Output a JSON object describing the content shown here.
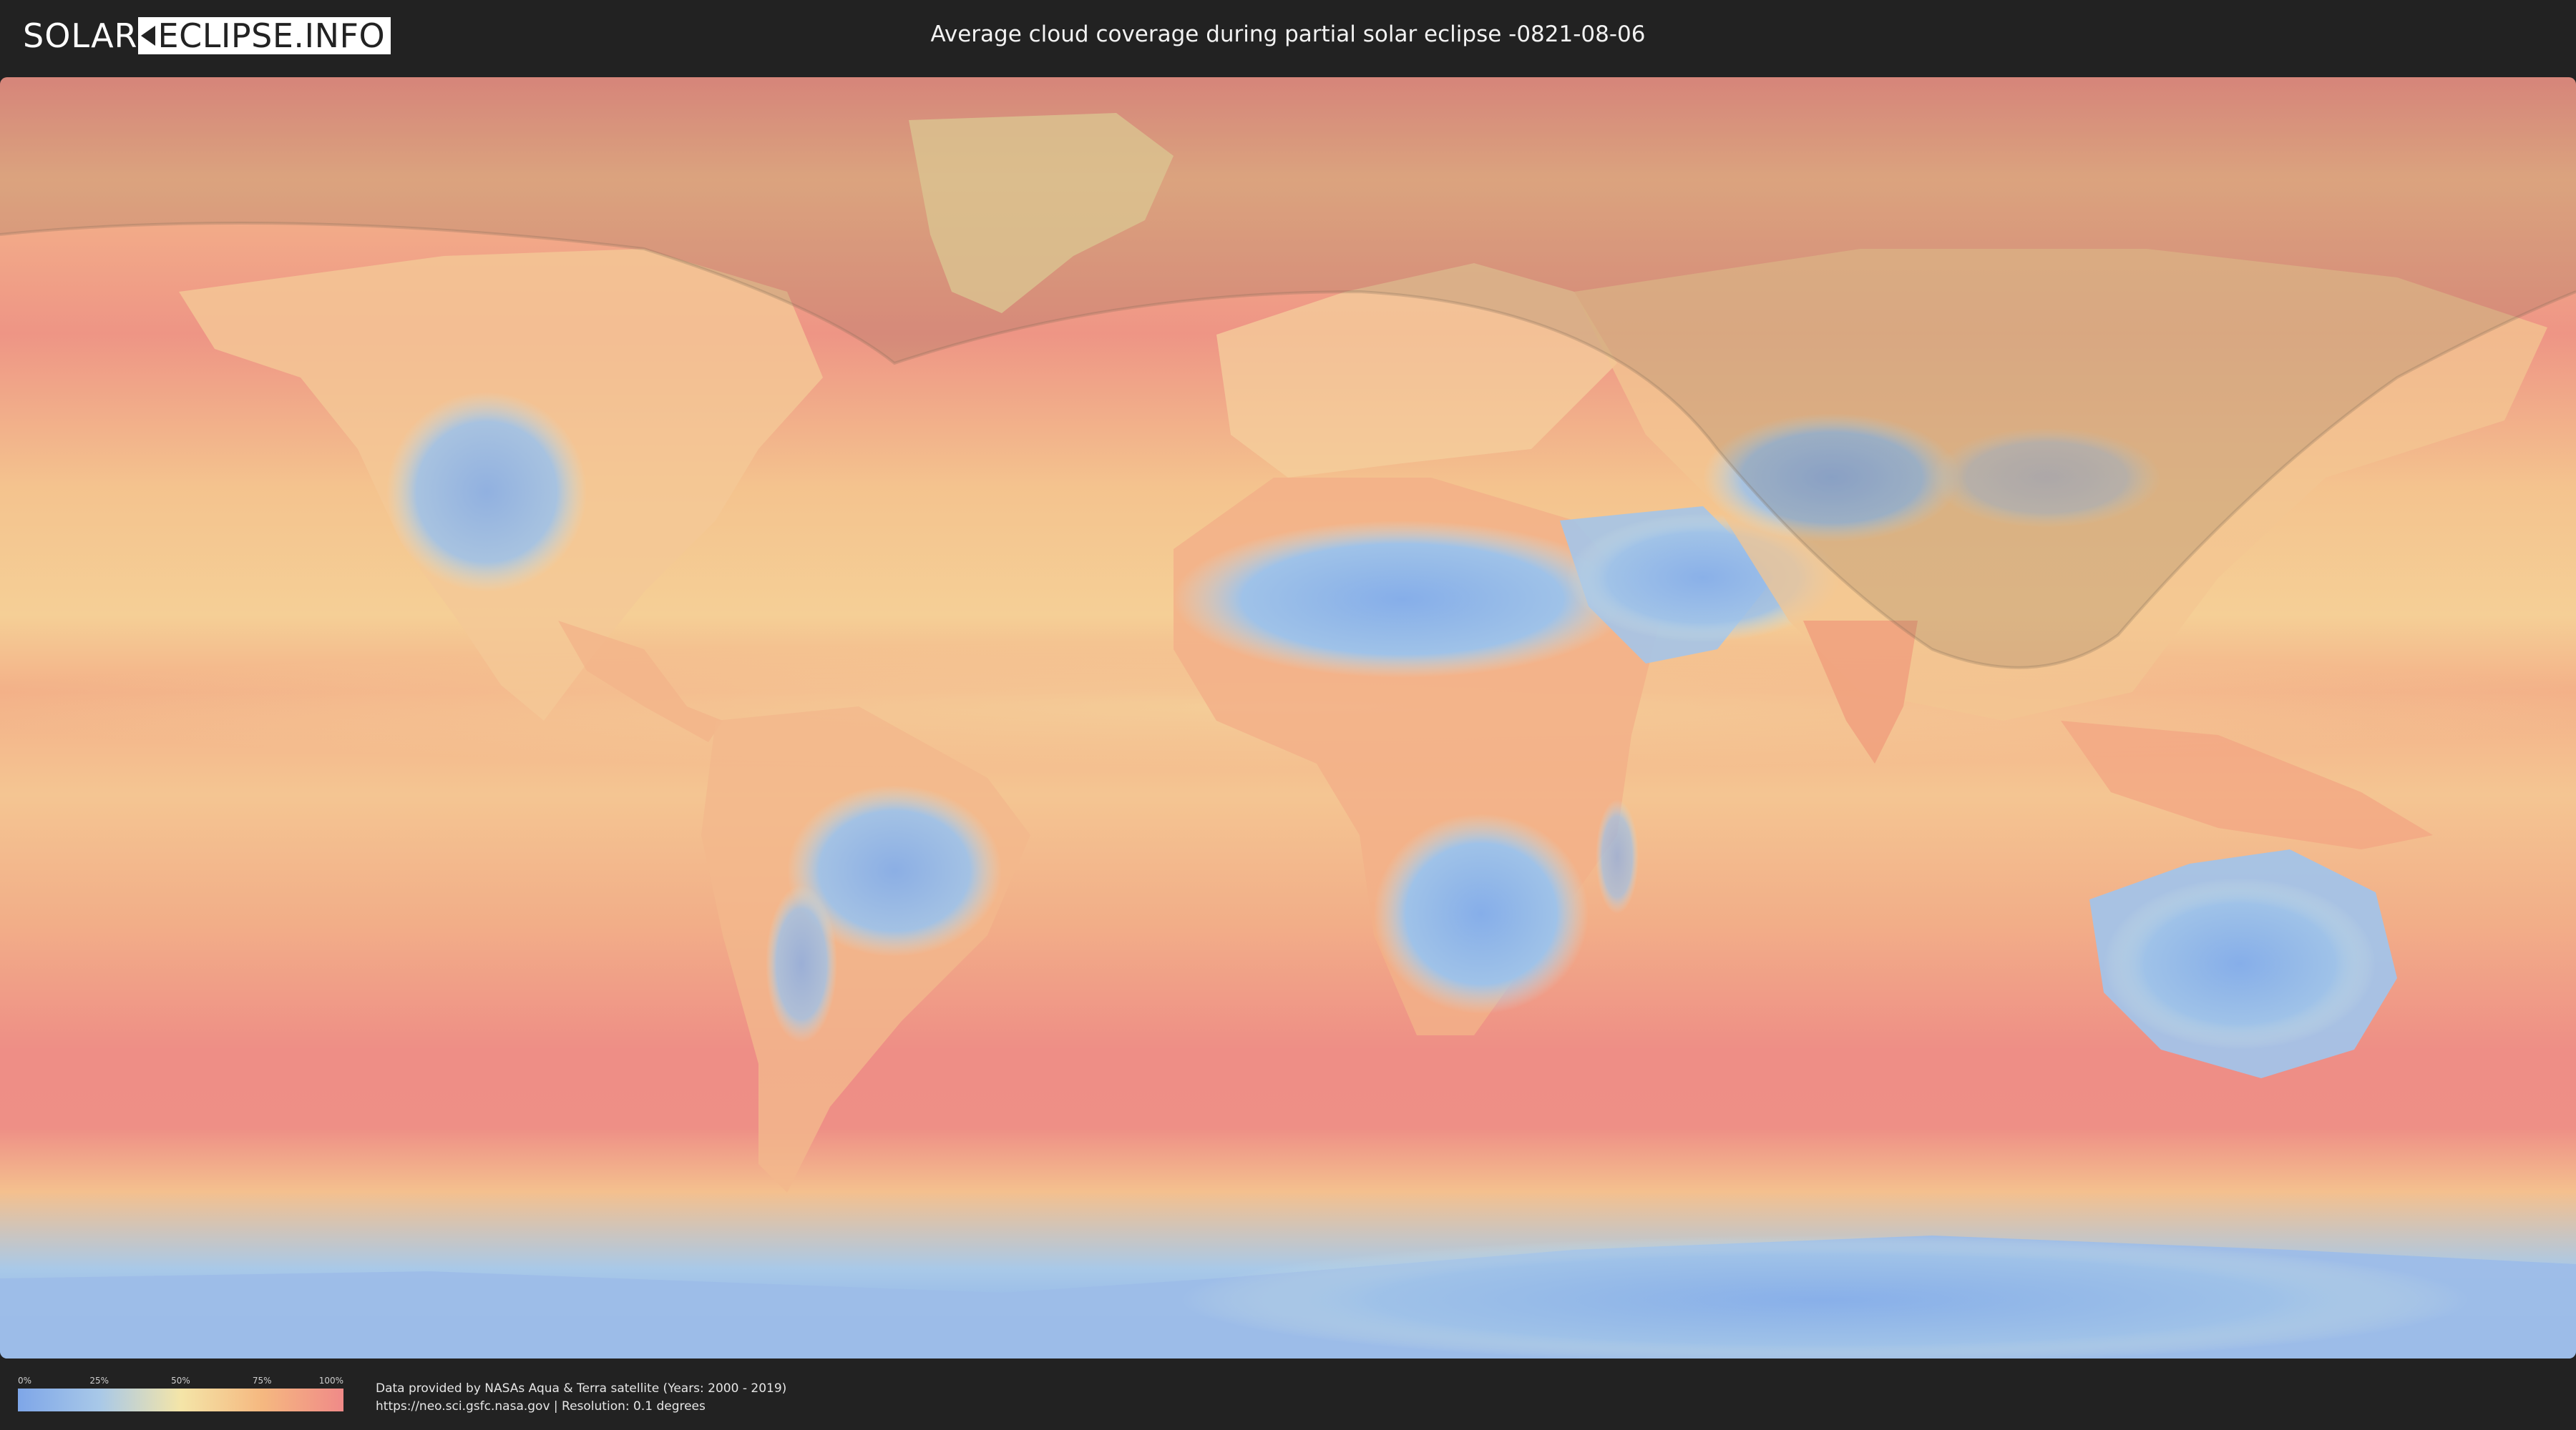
{
  "header": {
    "logo_left": "SOLAR",
    "logo_right": "ECLIPSE.INFO",
    "title": "Average cloud coverage during partial solar eclipse -0821-08-06"
  },
  "legend": {
    "ticks": [
      "0%",
      "25%",
      "50%",
      "75%",
      "100%"
    ],
    "tick_fractions": [
      0.0,
      0.25,
      0.5,
      0.75,
      1.0
    ],
    "colors": [
      "#7ea6e8",
      "#a8c8e8",
      "#f4e5a8",
      "#f5b880",
      "#f08a88"
    ]
  },
  "credits": {
    "line1": "Data provided by NASAs Aqua & Terra satellite (Years: 2000 - 2019)",
    "line2": "https://neo.sci.gsfc.nasa.gov | Resolution: 0.1 degrees"
  },
  "map": {
    "projection": "equirectangular",
    "ocean_color": "#f1a488",
    "land_clear_color": "#8fb2e6",
    "eclipse_shadow_color": "#6b5a4a"
  }
}
